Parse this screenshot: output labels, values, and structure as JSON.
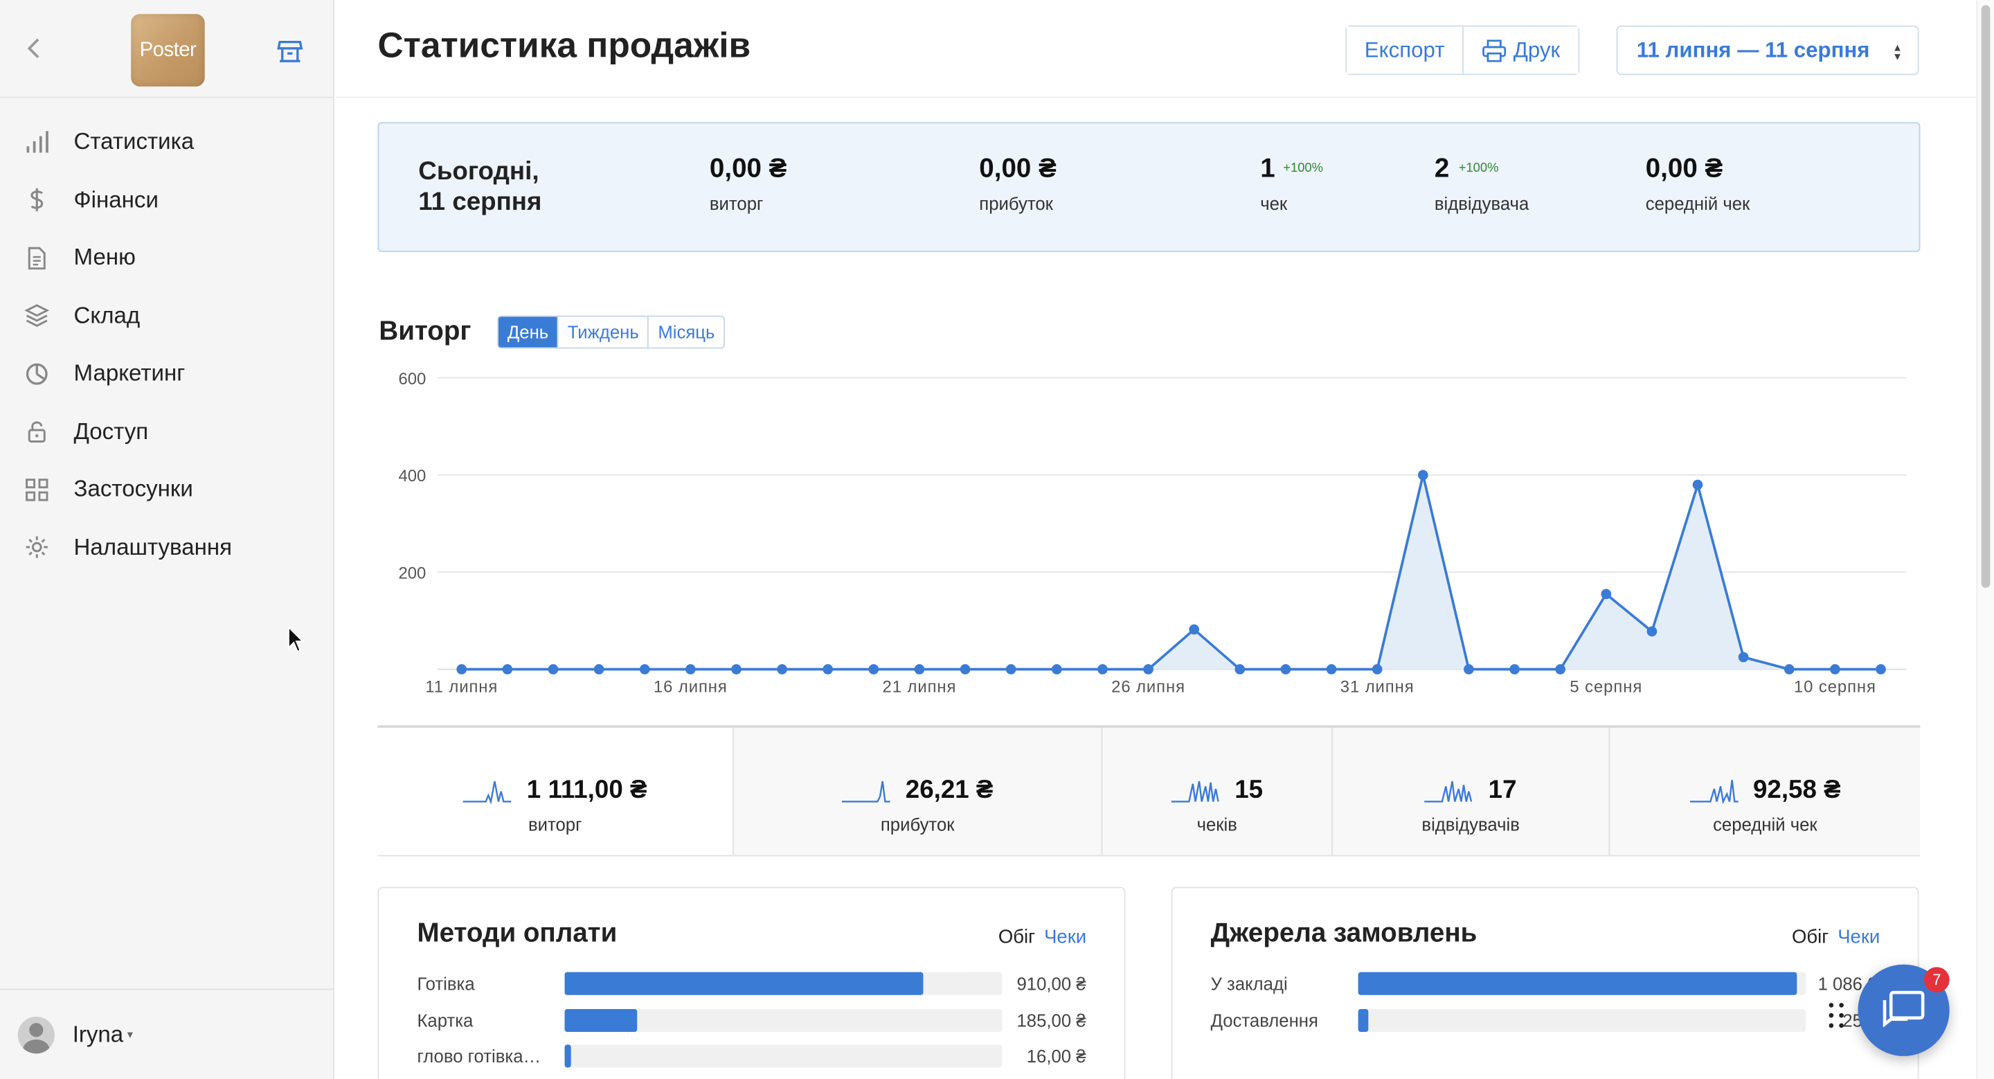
{
  "sidebar": {
    "logo_text": "Poster",
    "items": [
      {
        "label": "Статистика",
        "icon": "bar-chart-icon"
      },
      {
        "label": "Фінанси",
        "icon": "dollar-icon"
      },
      {
        "label": "Меню",
        "icon": "document-icon"
      },
      {
        "label": "Склад",
        "icon": "layers-icon"
      },
      {
        "label": "Маркетинг",
        "icon": "pie-icon"
      },
      {
        "label": "Доступ",
        "icon": "lock-icon"
      },
      {
        "label": "Застосунки",
        "icon": "grid-icon"
      },
      {
        "label": "Налаштування",
        "icon": "gear-icon"
      }
    ],
    "user_name": "Iryna"
  },
  "header": {
    "title": "Статистика продажів",
    "export_label": "Експорт",
    "print_label": "Друк",
    "date_range": "11 липня — 11 серпня"
  },
  "today": {
    "title_line1": "Сьогодні,",
    "title_line2": "11 серпня",
    "stats": [
      {
        "value": "0,00 ₴",
        "label": "виторг",
        "pct": ""
      },
      {
        "value": "0,00 ₴",
        "label": "прибуток",
        "pct": ""
      },
      {
        "value": "1",
        "label": "чек",
        "pct": "+100%"
      },
      {
        "value": "2",
        "label": "відвідувача",
        "pct": "+100%"
      },
      {
        "value": "0,00 ₴",
        "label": "середній чек",
        "pct": ""
      }
    ]
  },
  "revenue": {
    "title": "Виторг",
    "tabs": [
      "День",
      "Тиждень",
      "Місяць"
    ],
    "active_tab": 0
  },
  "chart_data": {
    "type": "area",
    "title": "",
    "xlabel": "",
    "ylabel": "",
    "ylim": [
      0,
      600
    ],
    "yticks": [
      200,
      400,
      600
    ],
    "x": [
      "11 липня",
      "12 липня",
      "13 липня",
      "14 липня",
      "15 липня",
      "16 липня",
      "17 липня",
      "18 липня",
      "19 липня",
      "20 липня",
      "21 липня",
      "22 липня",
      "23 липня",
      "24 липня",
      "25 липня",
      "26 липня",
      "27 липня",
      "28 липня",
      "29 липня",
      "30 липня",
      "31 липня",
      "1 серпня",
      "2 серпня",
      "3 серпня",
      "4 серпня",
      "5 серпня",
      "6 серпня",
      "7 серпня",
      "8 серпня",
      "9 серпня",
      "10 серпня",
      "11 серпня"
    ],
    "xtick_labels": [
      "11 липня",
      "16 липня",
      "21 липня",
      "26 липня",
      "31 липня",
      "5 серпня",
      "10 серпня"
    ],
    "xtick_index": [
      0,
      5,
      10,
      15,
      20,
      25,
      30
    ],
    "values": [
      0,
      0,
      0,
      0,
      0,
      0,
      0,
      0,
      0,
      0,
      0,
      0,
      0,
      0,
      0,
      0,
      82,
      0,
      0,
      0,
      0,
      400,
      0,
      0,
      0,
      155,
      78,
      380,
      25,
      0,
      0,
      0
    ],
    "color": "#3a7bd5",
    "grid": true
  },
  "summary": [
    {
      "value": "1 111,00 ₴",
      "label": "виторг"
    },
    {
      "value": "26,21 ₴",
      "label": "прибуток"
    },
    {
      "value": "15",
      "label": "чеків"
    },
    {
      "value": "17",
      "label": "відвідувачів"
    },
    {
      "value": "92,58 ₴",
      "label": "середній чек"
    }
  ],
  "payments": {
    "title": "Методи оплати",
    "toggle_a": "Обіг",
    "toggle_b": "Чеки",
    "rows": [
      {
        "label": "Готівка",
        "amount": "910,00 ₴",
        "fraction": 0.82
      },
      {
        "label": "Картка",
        "amount": "185,00 ₴",
        "fraction": 0.165
      },
      {
        "label": "глово готівка…",
        "amount": "16,00 ₴",
        "fraction": 0.015
      }
    ]
  },
  "sources": {
    "title": "Джерела замовлень",
    "toggle_a": "Обіг",
    "toggle_b": "Чеки",
    "rows": [
      {
        "label": "У закладі",
        "amount": "1 086,00",
        "fraction": 0.98
      },
      {
        "label": "Доставлення",
        "amount": "25,00",
        "fraction": 0.023
      }
    ]
  },
  "chat_badge": "7"
}
